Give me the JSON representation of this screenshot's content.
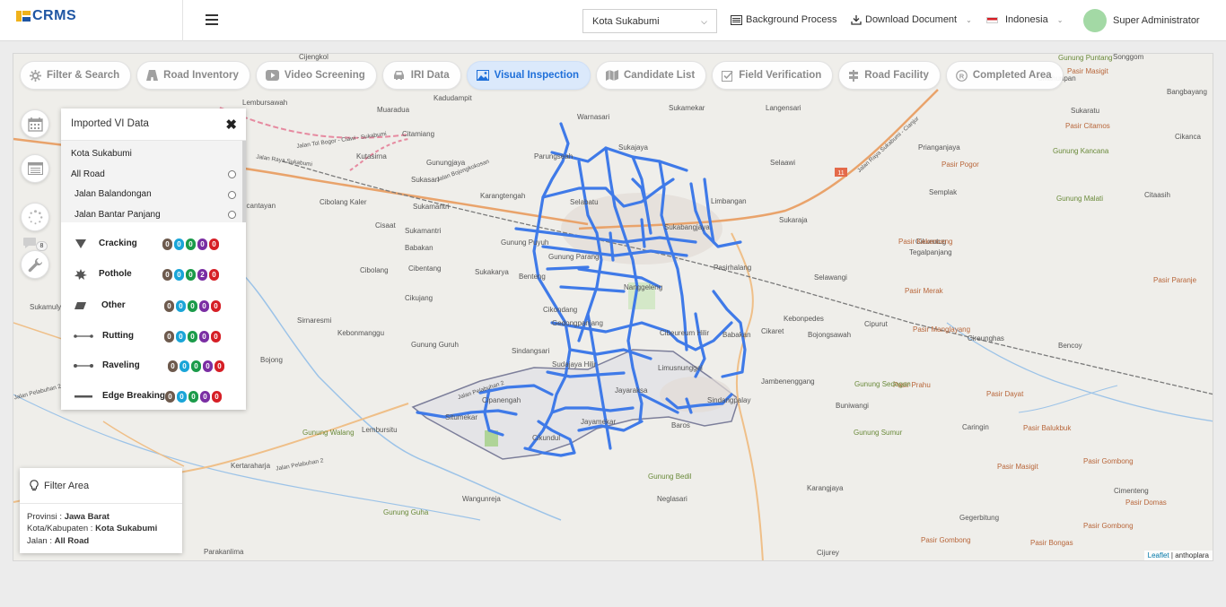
{
  "brand": {
    "name": "CRMS"
  },
  "header": {
    "city_select": "Kota Sukabumi",
    "background_process": "Background Process",
    "download_document": "Download Document",
    "language": "Indonesia",
    "user": "Super Administrator"
  },
  "tabs": [
    {
      "label": "Filter & Search",
      "icon": "gear-icon"
    },
    {
      "label": "Road Inventory",
      "icon": "road-icon"
    },
    {
      "label": "Video Screening",
      "icon": "video-icon"
    },
    {
      "label": "IRI Data",
      "icon": "car-icon"
    },
    {
      "label": "Visual Inspection",
      "icon": "image-icon",
      "active": true
    },
    {
      "label": "Candidate List",
      "icon": "map-icon"
    },
    {
      "label": "Field Verification",
      "icon": "checkbox-icon"
    },
    {
      "label": "Road Facility",
      "icon": "signpost-icon"
    },
    {
      "label": "Completed Area",
      "icon": "registered-icon"
    }
  ],
  "side_buttons": {
    "calendar": "calendar-icon",
    "list": "list-icon",
    "loading": "spinner-icon",
    "chat_badge": "8",
    "tools": "wrench-icon"
  },
  "vi_panel": {
    "title": "Imported VI Data",
    "city": "Kota Sukabumi",
    "items": [
      "All Road",
      "Jalan Balandongan",
      "Jalan Bantar Panjang"
    ],
    "damage_types": [
      {
        "name": "Cracking",
        "icon": "triangle-icon",
        "counts": [
          "0",
          "0",
          "0",
          "0",
          "0"
        ]
      },
      {
        "name": "Pothole",
        "icon": "splat-icon",
        "counts": [
          "0",
          "0",
          "0",
          "2",
          "0"
        ]
      },
      {
        "name": "Other",
        "icon": "parallelogram-icon",
        "counts": [
          "0",
          "0",
          "0",
          "0",
          "0"
        ]
      },
      {
        "name": "Rutting",
        "icon": "rutting-icon",
        "counts": [
          "0",
          "0",
          "0",
          "0",
          "0"
        ]
      },
      {
        "name": "Raveling",
        "icon": "raveling-icon",
        "counts": [
          "0",
          "0",
          "0",
          "0",
          "0"
        ]
      },
      {
        "name": "Edge Breaking",
        "icon": "edge-icon",
        "counts": [
          "0",
          "0",
          "0",
          "0",
          "0"
        ]
      }
    ],
    "count_colors": [
      "#6d5a4d",
      "#1aa5d8",
      "#1b9b4a",
      "#7a2ea3",
      "#d61f26"
    ]
  },
  "filter_area": {
    "title": "Filter Area",
    "province_label": "Provinsi :",
    "province": "Jawa Barat",
    "regency_label": "Kota/Kabupaten :",
    "regency": "Kota Sukabumi",
    "road_label": "Jalan :",
    "road": "All Road"
  },
  "map": {
    "attribution_link": "Leaflet",
    "attribution_text": "| anthoplara",
    "road_color": "#3f7ae8",
    "labels": [
      "Cijengkol",
      "Lembursawah",
      "Muaradua",
      "Kadudampit",
      "Warnasari",
      "Sukamekar",
      "Langensari",
      "Citamiang",
      "Gunungjaya",
      "Sukajaya",
      "Kutasirna",
      "Parungseah",
      "Selaawi",
      "Sukasari",
      "Karangtengah",
      "Cibolang Kaler",
      "Cicantayan",
      "Sukamantri",
      "Selabatu",
      "Limbangan",
      "Sukaraja",
      "Cisaat",
      "Sukamantri",
      "Gunung Puyuh",
      "Sukabangjaya",
      "Babakan",
      "Cibentang",
      "Sukakarya",
      "Gunung Parang",
      "Cibolang",
      "Benteng",
      "Pasirhalang",
      "Cikujang",
      "Nanggeleng",
      "Cikondang",
      "Sirnaresmi",
      "Gedongpanjang",
      "Cibeureum Hilir",
      "Kebonmanggu",
      "Babakan",
      "Cikaret",
      "Gunung Guruh",
      "Sindangsari",
      "Limusnunggal",
      "Bojong",
      "Sudajaya Hilir",
      "Jayaraksa",
      "Jambenenggang",
      "Cipanengah",
      "Situmekar",
      "Sindangpalay",
      "Jayamekar",
      "Baros",
      "Lembursitu",
      "Cikundul",
      "Kertaraharja",
      "Wangunreja",
      "Neglasari",
      "Parakanlima",
      "Cijurey",
      "Karangjaya",
      "Kebonpedes",
      "Bojongsawah",
      "Cipurut",
      "Cireunghas",
      "Selawangi",
      "Cikurutug",
      "Tegalpanjang",
      "Semplak",
      "Prianganjaya",
      "Cikahuripan",
      "Songgom",
      "Bangbayang",
      "Sukaratu",
      "Cikanca",
      "Citaasih",
      "Buniwangi",
      "Caringin",
      "Bencoy",
      "Gegerbitung",
      "Cimenteng",
      "Sukamulya"
    ],
    "poi_labels": [
      "Pasir Masigit",
      "Pasir Citamos",
      "Pasir Pogor",
      "Pasir Kekenceng",
      "Pasir Merak",
      "Pasir Paranje",
      "Pasir Manglayang",
      "Pasir Prahu",
      "Pasir Dayat",
      "Pasir Balukbuk",
      "Pasir Masigit",
      "Pasir Gombong",
      "Pasir Domas",
      "Pasir Gombong",
      "Pasir Gombong",
      "Pasir Bongas"
    ],
    "mountain_labels": [
      "Gunung Puntang",
      "Gunung Kancana",
      "Gunung Malati",
      "Gunung Sedogan",
      "Gunung Sumur",
      "Gunung Walang",
      "Gunung Bedil",
      "Gunung Guha"
    ],
    "road_name_labels": [
      "Jalan Tol Bogor - Ciawi - Sukabumi",
      "Jalan Raya Sukabumi",
      "Jalan Bojongkokosan",
      "Jalan Raya Sukabumi - Cianjur",
      "Jalan Pelabuhan 2",
      "Jalan Pelabuhan 2",
      "Jalan Pelabuhan 2"
    ],
    "route_shield": "11"
  }
}
